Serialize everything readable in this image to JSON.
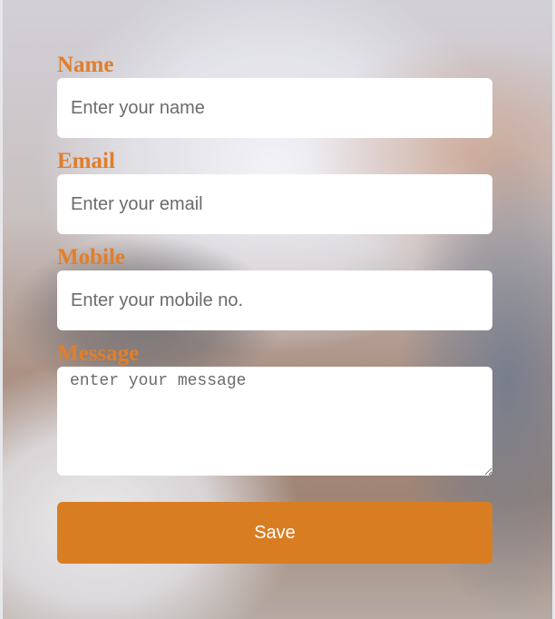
{
  "form": {
    "name": {
      "label": "Name",
      "placeholder": "Enter your name",
      "value": ""
    },
    "email": {
      "label": "Email",
      "placeholder": "Enter your email",
      "value": ""
    },
    "mobile": {
      "label": "Mobile",
      "placeholder": "Enter your mobile no.",
      "value": ""
    },
    "message": {
      "label": "Message",
      "placeholder": "enter your message",
      "value": ""
    },
    "save_label": "Save"
  },
  "colors": {
    "label": "#e07f2b",
    "button": "#d87d22",
    "button_text": "#ffffff",
    "field_bg": "#ffffff"
  }
}
